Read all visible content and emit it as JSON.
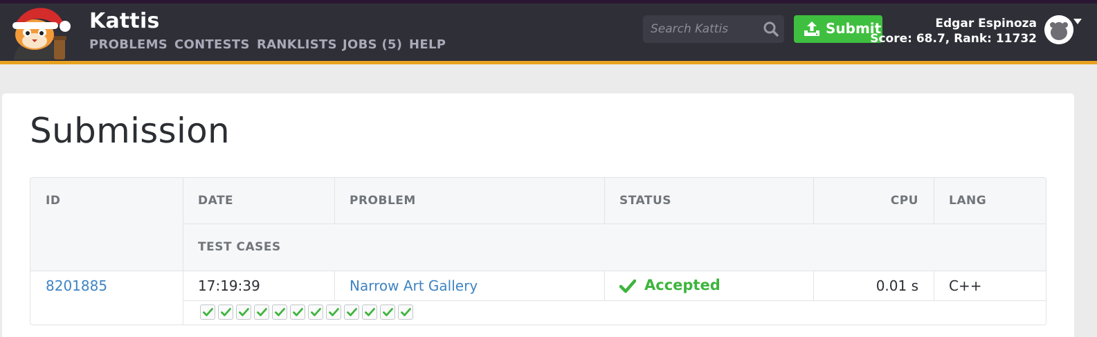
{
  "header": {
    "brand": "Kattis",
    "nav": [
      {
        "label": "PROBLEMS"
      },
      {
        "label": "CONTESTS"
      },
      {
        "label": "RANKLISTS"
      },
      {
        "label": "JOBS (5)"
      },
      {
        "label": "HELP"
      }
    ],
    "search": {
      "placeholder": "Search Kattis",
      "icon": "search-icon"
    },
    "submit_label": "Submit",
    "user": {
      "name": "Edgar Espinoza",
      "score_line": "Score: 68.7, Rank: 11732"
    }
  },
  "page": {
    "title": "Submission"
  },
  "table": {
    "headers": {
      "id": "ID",
      "date": "DATE",
      "problem": "PROBLEM",
      "status": "STATUS",
      "cpu": "CPU",
      "lang": "LANG",
      "test_cases": "TEST CASES"
    },
    "row": {
      "id": "8201885",
      "date": "17:19:39",
      "problem": "Narrow Art Gallery",
      "status": "Accepted",
      "cpu": "0.01 s",
      "lang": "C++",
      "test_cases_passed": 12,
      "test_cases_total": 12
    }
  },
  "colors": {
    "header_bg": "#2f2f38",
    "header_accent": "#e8a21e",
    "submit_green": "#3fbf3f",
    "accepted_green": "#3db43d",
    "link_blue": "#3f84c2"
  }
}
